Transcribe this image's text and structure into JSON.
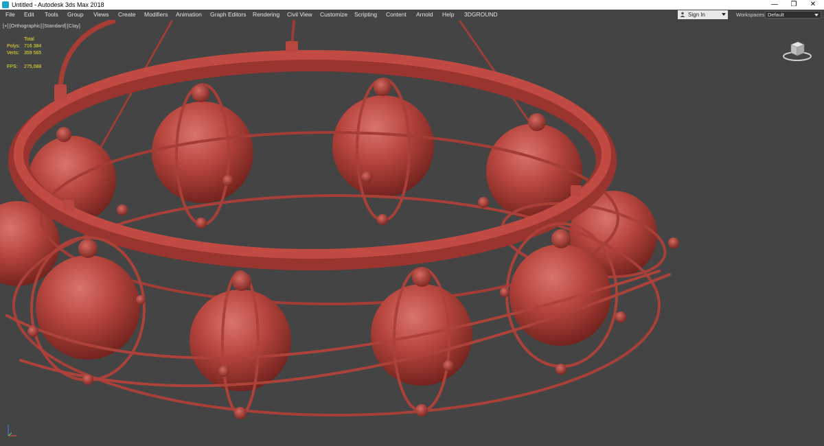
{
  "window": {
    "title": "Untitled - Autodesk 3ds Max 2018",
    "minimize_glyph": "—",
    "restore_glyph": "❐",
    "close_glyph": "✕"
  },
  "menu": {
    "items": [
      "File",
      "Edit",
      "Tools",
      "Group",
      "Views",
      "Create",
      "Modifiers",
      "Animation",
      "Graph Editors",
      "Rendering",
      "Civil View",
      "Customize",
      "Scripting",
      "Content",
      "Arnold",
      "Help",
      "3DGROUND"
    ],
    "signin_label": "Sign In",
    "workspaces_label": "Workspaces:",
    "workspaces_value": "Default"
  },
  "viewport": {
    "label_parts": [
      "[+]",
      "[Orthographic]",
      "[Standard]",
      "[Clay]"
    ],
    "stats": {
      "header": "Total",
      "polys_label": "Polys:",
      "polys_value": "716 384",
      "verts_label": "Verts:",
      "verts_value": "359 565",
      "fps_label": "FPS:",
      "fps_value": "275,088"
    },
    "background_color": "#444444",
    "clay_color": "#b5443d",
    "stats_color": "#e8e233"
  },
  "icons": {
    "viewcube": "viewcube-icon",
    "axis": "axis-tripod-icon",
    "user": "user-icon",
    "app": "3dsmax-app-icon"
  }
}
